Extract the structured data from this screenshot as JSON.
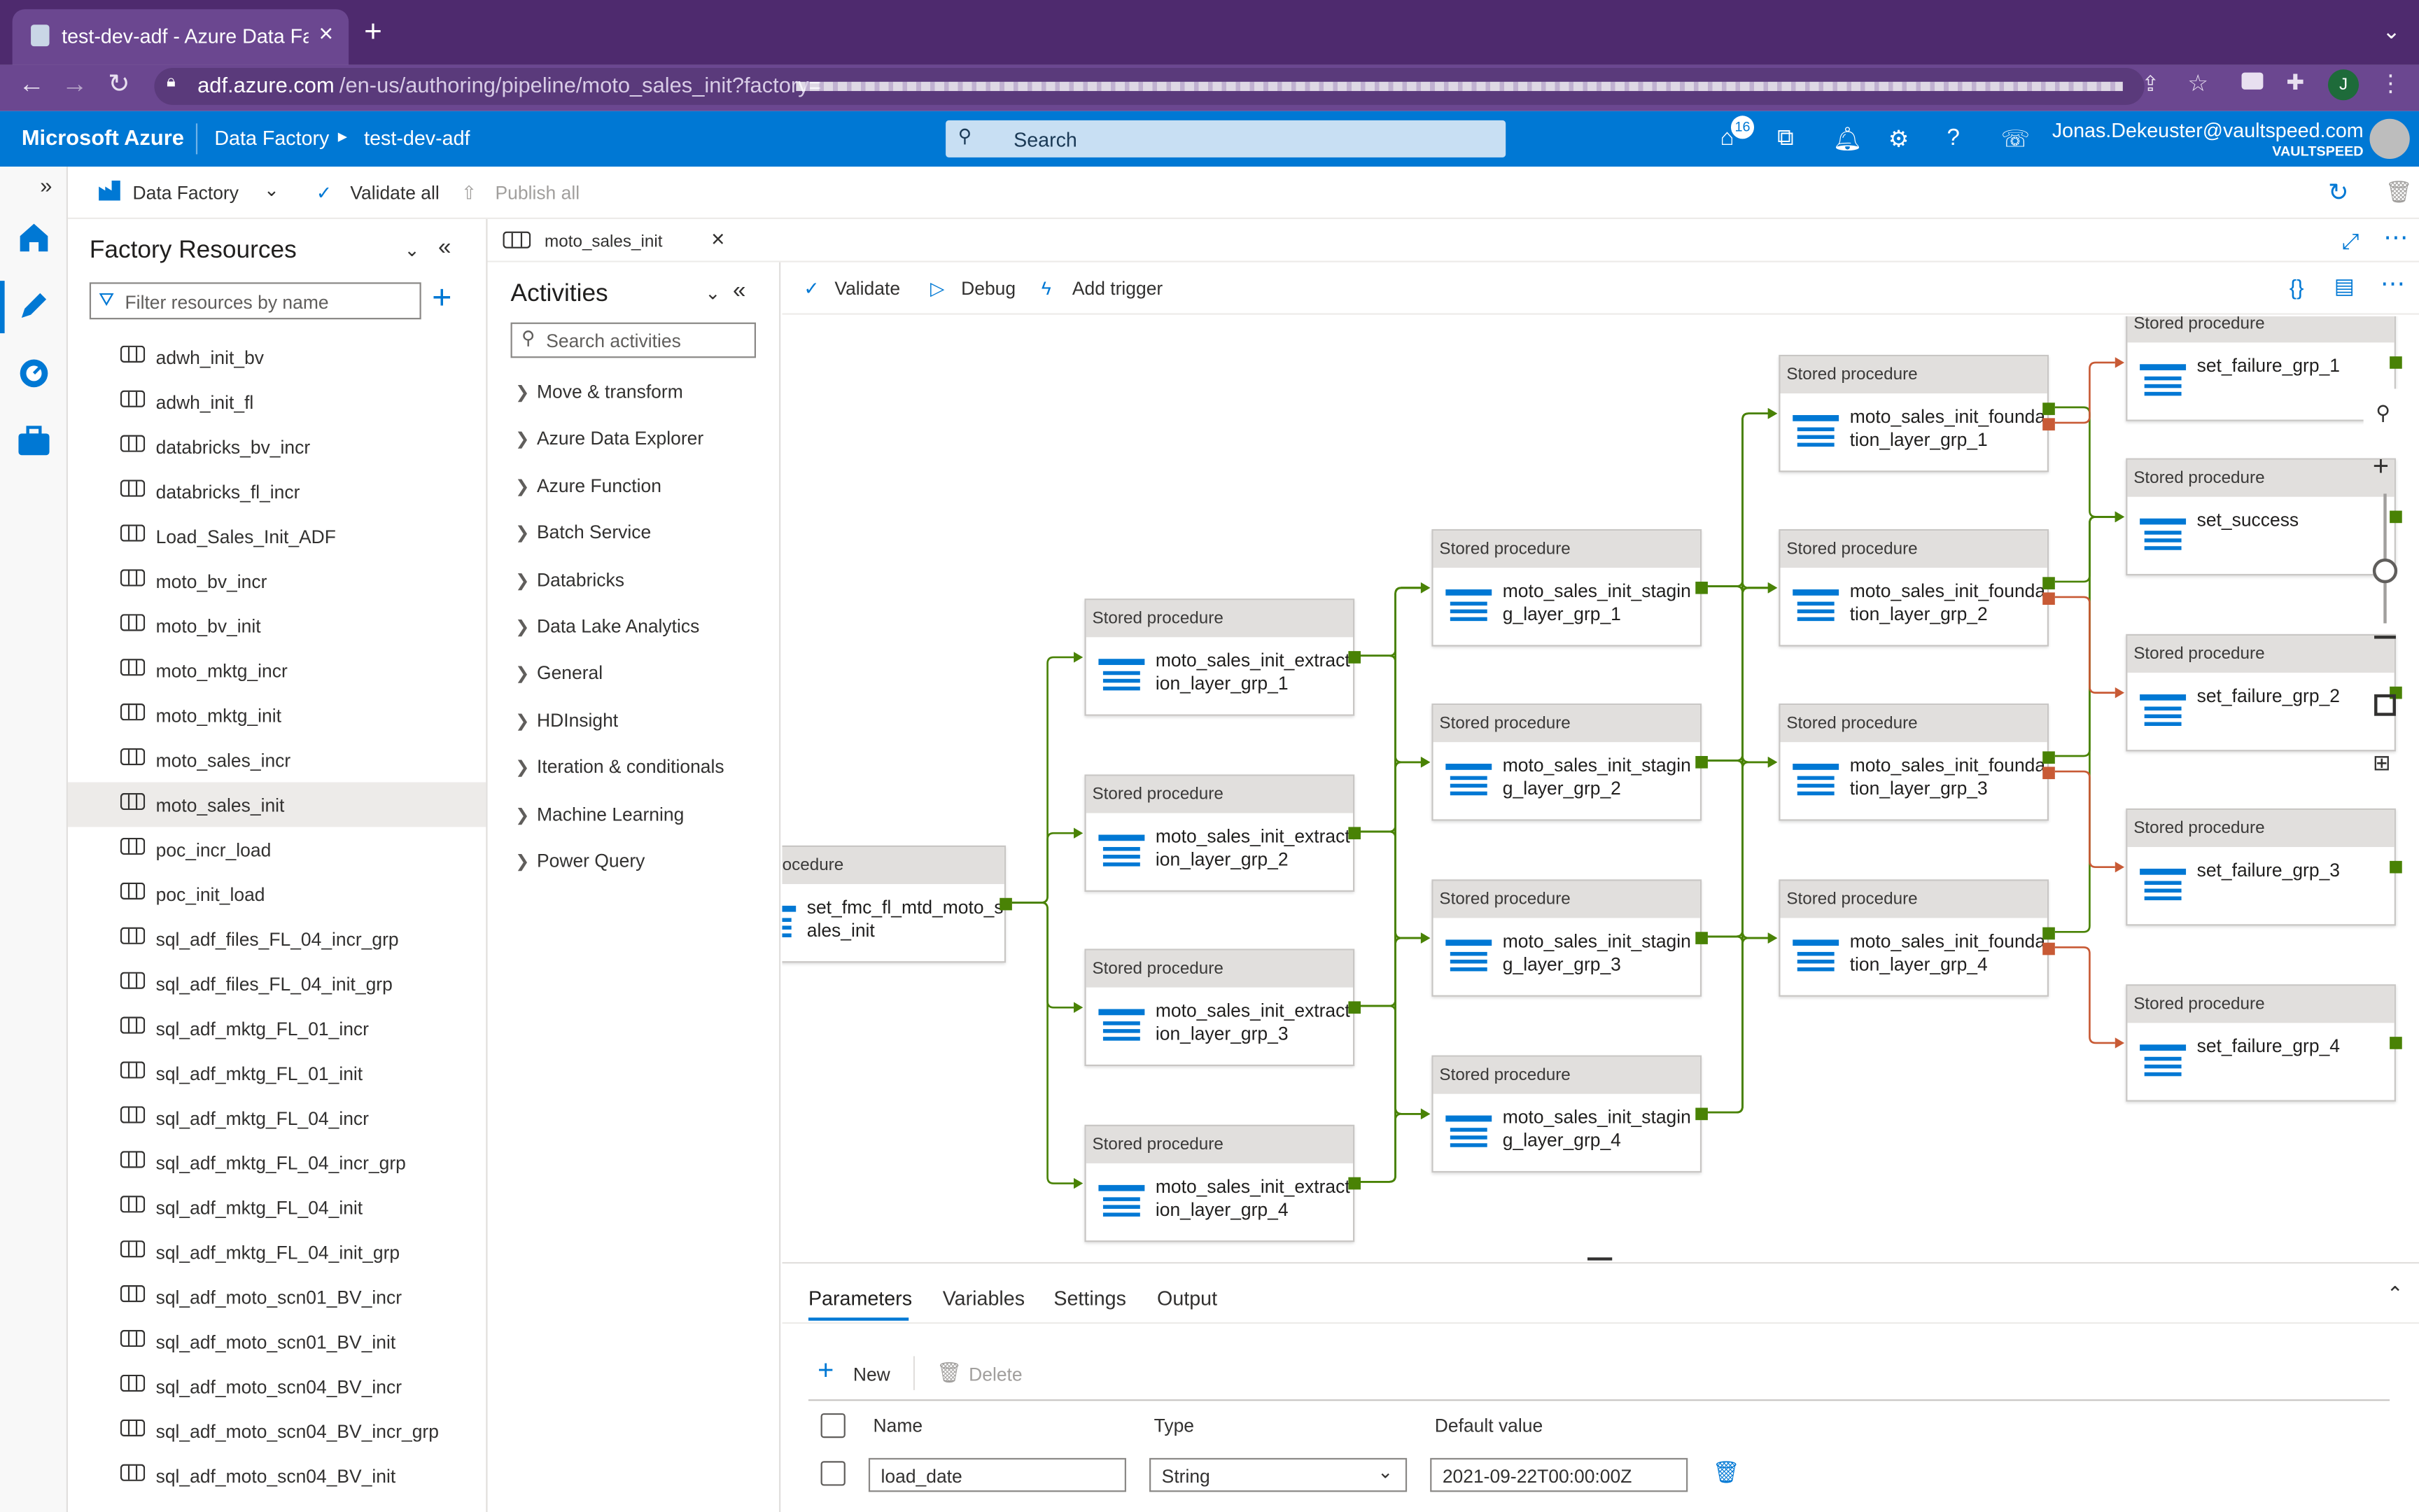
{
  "browser": {
    "tab_title": "test-dev-adf - Azure Data Fact",
    "new_tab": "+",
    "url_host": "adf.azure.com",
    "url_path": "/en-us/authoring/pipeline/moto_sales_init?factory=",
    "profile_initial": "J"
  },
  "azure": {
    "brand": "Microsoft Azure",
    "service": "Data Factory",
    "instance": "test-dev-adf",
    "search_placeholder": "Search",
    "notification_count": "16",
    "user_email": "Jonas.Dekeuster@vaultspeed.com",
    "user_org": "VAULTSPEED"
  },
  "toolbar": {
    "factory": "Data Factory",
    "validate_all": "Validate all",
    "publish_all": "Publish all"
  },
  "resources": {
    "title": "Factory Resources",
    "filter_placeholder": "Filter resources by name",
    "items": [
      "adwh_init_bv",
      "adwh_init_fl",
      "databricks_bv_incr",
      "databricks_fl_incr",
      "Load_Sales_Init_ADF",
      "moto_bv_incr",
      "moto_bv_init",
      "moto_mktg_incr",
      "moto_mktg_init",
      "moto_sales_incr",
      "moto_sales_init",
      "poc_incr_load",
      "poc_init_load",
      "sql_adf_files_FL_04_incr_grp",
      "sql_adf_files_FL_04_init_grp",
      "sql_adf_mktg_FL_01_incr",
      "sql_adf_mktg_FL_01_init",
      "sql_adf_mktg_FL_04_incr",
      "sql_adf_mktg_FL_04_incr_grp",
      "sql_adf_mktg_FL_04_init",
      "sql_adf_mktg_FL_04_init_grp",
      "sql_adf_moto_scn01_BV_incr",
      "sql_adf_moto_scn01_BV_init",
      "sql_adf_moto_scn04_BV_incr",
      "sql_adf_moto_scn04_BV_incr_grp",
      "sql_adf_moto_scn04_BV_init"
    ],
    "selected": "moto_sales_init"
  },
  "doc_tab": {
    "label": "moto_sales_init"
  },
  "activities": {
    "title": "Activities",
    "search_placeholder": "Search activities",
    "categories": [
      "Move & transform",
      "Azure Data Explorer",
      "Azure Function",
      "Batch Service",
      "Databricks",
      "Data Lake Analytics",
      "General",
      "HDInsight",
      "Iteration & conditionals",
      "Machine Learning",
      "Power Query"
    ]
  },
  "pipeline_toolbar": {
    "validate": "Validate",
    "debug": "Debug",
    "add_trigger": "Add trigger"
  },
  "nodes": {
    "start": {
      "type": "ed procedure",
      "name": "set_fmc_fl_mtd_moto_sales_init"
    },
    "extraction": [
      {
        "type": "Stored procedure",
        "name": "moto_sales_init_extraction_layer_grp_1"
      },
      {
        "type": "Stored procedure",
        "name": "moto_sales_init_extraction_layer_grp_2"
      },
      {
        "type": "Stored procedure",
        "name": "moto_sales_init_extraction_layer_grp_3"
      },
      {
        "type": "Stored procedure",
        "name": "moto_sales_init_extraction_layer_grp_4"
      }
    ],
    "staging": [
      {
        "type": "Stored procedure",
        "name": "moto_sales_init_staging_layer_grp_1"
      },
      {
        "type": "Stored procedure",
        "name": "moto_sales_init_staging_layer_grp_2"
      },
      {
        "type": "Stored procedure",
        "name": "moto_sales_init_staging_layer_grp_3"
      },
      {
        "type": "Stored procedure",
        "name": "moto_sales_init_staging_layer_grp_4"
      }
    ],
    "foundation": [
      {
        "type": "Stored procedure",
        "name": "moto_sales_init_foundation_layer_grp_1"
      },
      {
        "type": "Stored procedure",
        "name": "moto_sales_init_foundation_layer_grp_2"
      },
      {
        "type": "Stored procedure",
        "name": "moto_sales_init_foundation_layer_grp_3"
      },
      {
        "type": "Stored procedure",
        "name": "moto_sales_init_foundation_layer_grp_4"
      }
    ],
    "final": [
      {
        "type": "Stored procedure",
        "name": "set_failure_grp_1"
      },
      {
        "type": "Stored procedure",
        "name": "set_success"
      },
      {
        "type": "Stored procedure",
        "name": "set_failure_grp_2"
      },
      {
        "type": "Stored procedure",
        "name": "set_failure_grp_3"
      },
      {
        "type": "Stored procedure",
        "name": "set_failure_grp_4"
      }
    ]
  },
  "bottom": {
    "tabs": [
      "Parameters",
      "Variables",
      "Settings",
      "Output"
    ],
    "active_tab": "Parameters",
    "new_label": "New",
    "delete_label": "Delete",
    "columns": {
      "name": "Name",
      "type": "Type",
      "default": "Default value"
    },
    "row": {
      "name": "load_date",
      "type": "String",
      "default": "2021-09-22T00:00:00Z"
    }
  },
  "colors": {
    "azure_blue": "#0078d4",
    "success_port": "#498205",
    "failure_port": "#c85a35",
    "chrome_purple": "#4e2a6e"
  }
}
